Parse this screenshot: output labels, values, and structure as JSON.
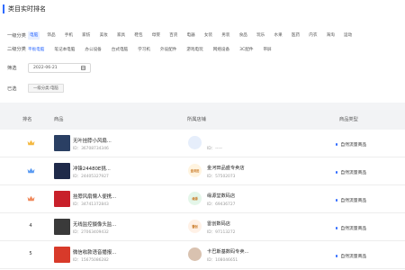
{
  "page_title": "类目实时排名",
  "level1": {
    "label": "一级分类",
    "items": [
      "电脑",
      "饰品",
      "手机",
      "家纺",
      "美妆",
      "家具",
      "鞋包",
      "母婴",
      "百货",
      "电器",
      "女装",
      "男装",
      "食品",
      "玩乐",
      "水果",
      "医药",
      "内衣",
      "海淘",
      "运动"
    ],
    "active_index": 0
  },
  "level2": {
    "label": "二级分类",
    "items": [
      "平板电脑",
      "笔记本电脑",
      "办公设备",
      "台式电脑",
      "学习机",
      "外设配件",
      "游戏电玩",
      "网络设备",
      "3C配件",
      "带屏"
    ],
    "active_index": 0
  },
  "filter": {
    "label": "筛选",
    "date": "2022-06-21",
    "calendar_icon": "calendar-icon"
  },
  "selected": {
    "label": "已选",
    "chip": "一级分类:电脑"
  },
  "table": {
    "headers": {
      "rank": "排名",
      "product": "商品",
      "shop": "所属店铺",
      "type": "商品类型"
    },
    "rows": [
      {
        "rank": "",
        "rank_icon": "crown-icon",
        "rank_color": "#f4b942",
        "product_name": "无叶挂脖小风扇...",
        "product_id": "ID：36708734346",
        "shop_name": "",
        "shop_id": "ID：-----",
        "shop_logo": "",
        "shop_logo_color": "#e6eefb",
        "type": "自然流量商品",
        "thumb_color": "#2a3f63"
      },
      {
        "rank": "",
        "rank_icon": "crown-icon",
        "rank_color": "#5b9bf2",
        "product_name": "冲锋24480E挑...",
        "product_id": "ID：24405327927",
        "shop_name": "金河田品盛专卖店",
        "shop_id": "ID：57502073",
        "shop_logo": "金河田",
        "shop_logo_color": "#fff4e0",
        "type": "自然流量商品",
        "thumb_color": "#1f2a4a"
      },
      {
        "rank": "",
        "rank_icon": "crown-icon",
        "rank_color": "#f08a5d",
        "product_name": "挂脖风扇懒人便携...",
        "product_id": "ID：34741372843",
        "shop_name": "缘源堂数码店",
        "shop_id": "ID：69436727",
        "shop_logo": "缘源",
        "shop_logo_color": "#e4f6e9",
        "type": "自然流量商品",
        "thumb_color": "#c8202a"
      },
      {
        "rank": "4",
        "rank_icon": "",
        "rank_color": "#333333",
        "product_name": "无线监控摄像头监...",
        "product_id": "ID：27063409432",
        "shop_name": "雷创数码店",
        "shop_id": "ID：97113272",
        "shop_logo": "雷创",
        "shop_logo_color": "#fff1e6",
        "type": "自然流量商品",
        "thumb_color": "#3a3a3a"
      },
      {
        "rank": "5",
        "rank_icon": "",
        "rank_color": "#333333",
        "product_name": "微信收款语音播报...",
        "product_id": "ID：15675086282",
        "shop_name": "卡巴斯基数码专卖...",
        "shop_id": "ID：108046651",
        "shop_logo": "",
        "shop_logo_color": "#d9c2b0",
        "type": "自然流量商品",
        "thumb_color": "#d83a2a"
      }
    ]
  }
}
